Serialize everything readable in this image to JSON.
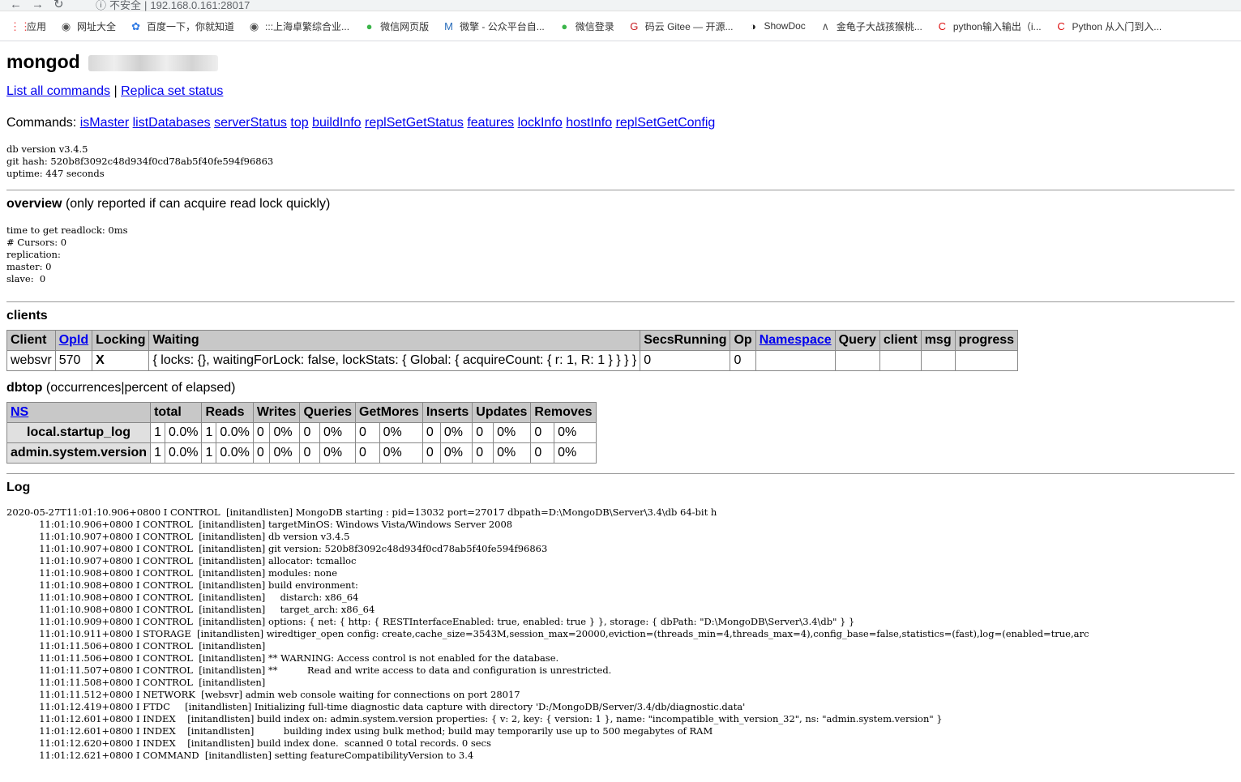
{
  "browser": {
    "insecure_label": "不安全",
    "url": "192.168.0.161:28017",
    "bookmarks": [
      {
        "icon": "apps-grid-icon",
        "label": "应用"
      },
      {
        "icon": "globe-icon",
        "label": "网址大全"
      },
      {
        "icon": "baidu-paw-icon",
        "label": "百度一下，你就知道"
      },
      {
        "icon": "globe-icon",
        "label": ":::上海卓繁综合业..."
      },
      {
        "icon": "wechat-icon",
        "label": "微信网页版"
      },
      {
        "icon": "m-logo-icon",
        "label": "微擎 - 公众平台自..."
      },
      {
        "icon": "wechat-icon",
        "label": "微信登录"
      },
      {
        "icon": "gitee-icon",
        "label": "码云 Gitee — 开源..."
      },
      {
        "icon": "showdoc-icon",
        "label": "ShowDoc"
      },
      {
        "icon": "link-icon",
        "label": "金龟子大战孩猴桃..."
      },
      {
        "icon": "c-logo-icon",
        "label": "python输入输出（i..."
      },
      {
        "icon": "c-logo-icon",
        "label": "Python 从入门到入..."
      }
    ]
  },
  "title": "mongod",
  "links": {
    "list_all": "List all commands",
    "sep": "|",
    "replica": "Replica set status"
  },
  "commands": {
    "label": "Commands:",
    "items": [
      "isMaster",
      "listDatabases",
      "serverStatus",
      "top",
      "buildInfo",
      "replSetGetStatus",
      "features",
      "lockInfo",
      "hostInfo",
      "replSetGetConfig"
    ]
  },
  "version_info": "db version v3.4.5\ngit hash: 520b8f3092c48d934f0cd78ab5f40fe594f96863\nuptime: 447 seconds",
  "overview": {
    "title": "overview",
    "note": "(only reported if can acquire read lock quickly)",
    "body": "time to get readlock: 0ms\n# Cursors: 0\nreplication:\nmaster: 0\nslave:  0"
  },
  "clients": {
    "title": "clients",
    "headers": [
      "Client",
      "OpId",
      "Locking",
      "Waiting",
      "SecsRunning",
      "Op",
      "Namespace",
      "Query",
      "client",
      "msg",
      "progress"
    ],
    "rows": [
      [
        "websvr",
        "570",
        "X",
        "{ locks: {}, waitingForLock: false, lockStats: { Global: { acquireCount: { r: 1, R: 1 } } } }",
        "0",
        "0",
        "",
        "",
        "",
        "",
        ""
      ]
    ]
  },
  "dbtop": {
    "title": "dbtop",
    "note": "(occurrences|percent of elapsed)",
    "headers": [
      "NS",
      "total",
      "Reads",
      "Writes",
      "Queries",
      "GetMores",
      "Inserts",
      "Updates",
      "Removes"
    ],
    "rows": [
      {
        "ns": "local.startup_log",
        "cells": [
          "1",
          "0.0%",
          "1",
          "0.0%",
          "0",
          "0%",
          "0",
          "0%",
          "0",
          "0%",
          "0",
          "0%",
          "0",
          "0%",
          "0",
          "0%"
        ]
      },
      {
        "ns": "admin.system.version",
        "cells": [
          "1",
          "0.0%",
          "1",
          "0.0%",
          "0",
          "0%",
          "0",
          "0%",
          "0",
          "0%",
          "0",
          "0%",
          "0",
          "0%",
          "0",
          "0%"
        ]
      }
    ]
  },
  "log": {
    "title": "Log",
    "text": "2020-05-27T11:01:10.906+0800 I CONTROL  [initandlisten] MongoDB starting : pid=13032 port=27017 dbpath=D:\\MongoDB\\Server\\3.4\\db 64-bit h\n           11:01:10.906+0800 I CONTROL  [initandlisten] targetMinOS: Windows Vista/Windows Server 2008\n           11:01:10.907+0800 I CONTROL  [initandlisten] db version v3.4.5\n           11:01:10.907+0800 I CONTROL  [initandlisten] git version: 520b8f3092c48d934f0cd78ab5f40fe594f96863\n           11:01:10.907+0800 I CONTROL  [initandlisten] allocator: tcmalloc\n           11:01:10.908+0800 I CONTROL  [initandlisten] modules: none\n           11:01:10.908+0800 I CONTROL  [initandlisten] build environment:\n           11:01:10.908+0800 I CONTROL  [initandlisten]     distarch: x86_64\n           11:01:10.908+0800 I CONTROL  [initandlisten]     target_arch: x86_64\n           11:01:10.909+0800 I CONTROL  [initandlisten] options: { net: { http: { RESTInterfaceEnabled: true, enabled: true } }, storage: { dbPath: \"D:\\MongoDB\\Server\\3.4\\db\" } }\n           11:01:10.911+0800 I STORAGE  [initandlisten] wiredtiger_open config: create,cache_size=3543M,session_max=20000,eviction=(threads_min=4,threads_max=4),config_base=false,statistics=(fast),log=(enabled=true,arc\n           11:01:11.506+0800 I CONTROL  [initandlisten]\n           11:01:11.506+0800 I CONTROL  [initandlisten] ** WARNING: Access control is not enabled for the database.\n           11:01:11.507+0800 I CONTROL  [initandlisten] **          Read and write access to data and configuration is unrestricted.\n           11:01:11.508+0800 I CONTROL  [initandlisten]\n           11:01:11.512+0800 I NETWORK  [websvr] admin web console waiting for connections on port 28017\n           11:01:12.419+0800 I FTDC     [initandlisten] Initializing full-time diagnostic data capture with directory 'D:/MongoDB/Server/3.4/db/diagnostic.data'\n           11:01:12.601+0800 I INDEX    [initandlisten] build index on: admin.system.version properties: { v: 2, key: { version: 1 }, name: \"incompatible_with_version_32\", ns: \"admin.system.version\" }\n           11:01:12.601+0800 I INDEX    [initandlisten]          building index using bulk method; build may temporarily use up to 500 megabytes of RAM\n           11:01:12.620+0800 I INDEX    [initandlisten] build index done.  scanned 0 total records. 0 secs\n           11:01:12.621+0800 I COMMAND  [initandlisten] setting featureCompatibilityVersion to 3.4"
  }
}
